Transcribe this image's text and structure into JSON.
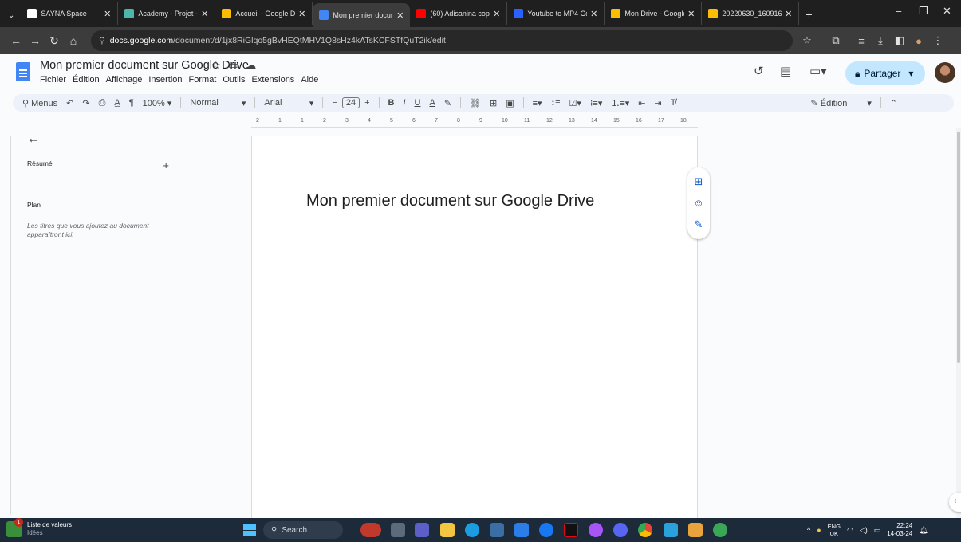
{
  "browser": {
    "tabs": [
      {
        "label": "SAYNA Space",
        "color": "#ffffff",
        "icon": "sayna-icon",
        "active": false
      },
      {
        "label": "Academy - Projet - [",
        "color": "#4db6ac",
        "icon": "academy-icon",
        "active": false
      },
      {
        "label": "Accueil - Google Dri",
        "color": "#fbbc04",
        "icon": "drive-icon",
        "active": false
      },
      {
        "label": "Mon premier docum",
        "color": "#4285f4",
        "icon": "docs-icon",
        "active": true
      },
      {
        "label": "(60) Adisanina copa",
        "color": "#ff0000",
        "icon": "youtube-icon",
        "active": false
      },
      {
        "label": "Youtube to MP4 Con",
        "color": "#2962ff",
        "icon": "converter-icon",
        "active": false
      },
      {
        "label": "Mon Drive - Google",
        "color": "#fbbc04",
        "icon": "drive-icon",
        "active": false
      },
      {
        "label": "20220630_160916.jp",
        "color": "#fbbc04",
        "icon": "drive-icon",
        "active": false
      }
    ],
    "url_host": "docs.google.com",
    "url_path": "/document/d/1jx8RiGlqo5gBvHEQtMHV1Q8sHz4kATsKCFSTfQuT2ik/edit"
  },
  "doc": {
    "title": "Mon premier document sur Google Drive",
    "menus": [
      "Fichier",
      "Édition",
      "Affichage",
      "Insertion",
      "Format",
      "Outils",
      "Extensions",
      "Aide"
    ],
    "share_label": "Partager",
    "toolbar": {
      "search_menus": "Menus",
      "zoom": "100%",
      "style": "Normal",
      "font": "Arial",
      "font_size": "24",
      "mode": "Édition"
    },
    "ruler_numbers": [
      "2",
      "1",
      "1",
      "2",
      "3",
      "4",
      "5",
      "6",
      "7",
      "8",
      "9",
      "10",
      "11",
      "12",
      "13",
      "14",
      "15",
      "16",
      "17",
      "18"
    ],
    "outline": {
      "summary_label": "Résumé",
      "plan_label": "Plan",
      "plan_hint": "Les titres que vous ajoutez au document apparaîtront ici."
    },
    "body_heading": "Mon premier document sur Google Drive"
  },
  "taskbar": {
    "widget_title": "Liste de valeurs",
    "widget_sub": "Idées",
    "search_placeholder": "Search",
    "lang_top": "ENG",
    "lang_bottom": "UK",
    "time": "22:24",
    "date": "14-03-24"
  }
}
